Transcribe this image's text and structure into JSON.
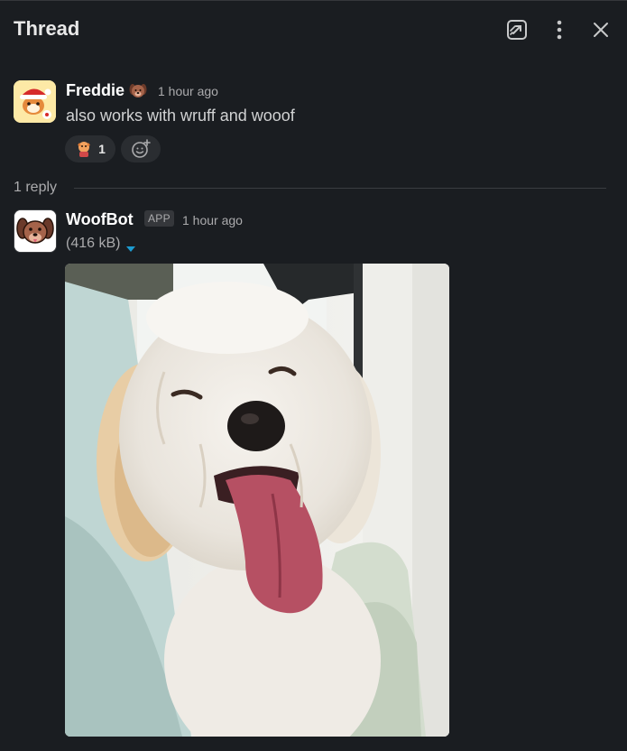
{
  "header": {
    "title": "Thread",
    "icons": [
      "open-in-window-icon",
      "more-vertical-icon",
      "close-icon"
    ]
  },
  "parent_message": {
    "author": "Freddie",
    "status_icon": "dog-face-icon",
    "timestamp": "1 hour ago",
    "text": "also works with wruff and wooof",
    "reaction": {
      "icon": "reaction-emoji-icon",
      "count": "1"
    },
    "add_reaction_icon": "add-reaction-icon"
  },
  "replies": {
    "count_label": "1 reply"
  },
  "reply_message": {
    "author": "WoofBot",
    "badge": "APP",
    "timestamp": "1 hour ago",
    "file_size": "(416 kB)",
    "toggle_icon": "caret-down-icon",
    "image_icon": "dog-photo"
  },
  "colors": {
    "background": "#1a1d21",
    "accent_caret": "#1d9bd1",
    "reaction_bg": "#2a2d31"
  }
}
